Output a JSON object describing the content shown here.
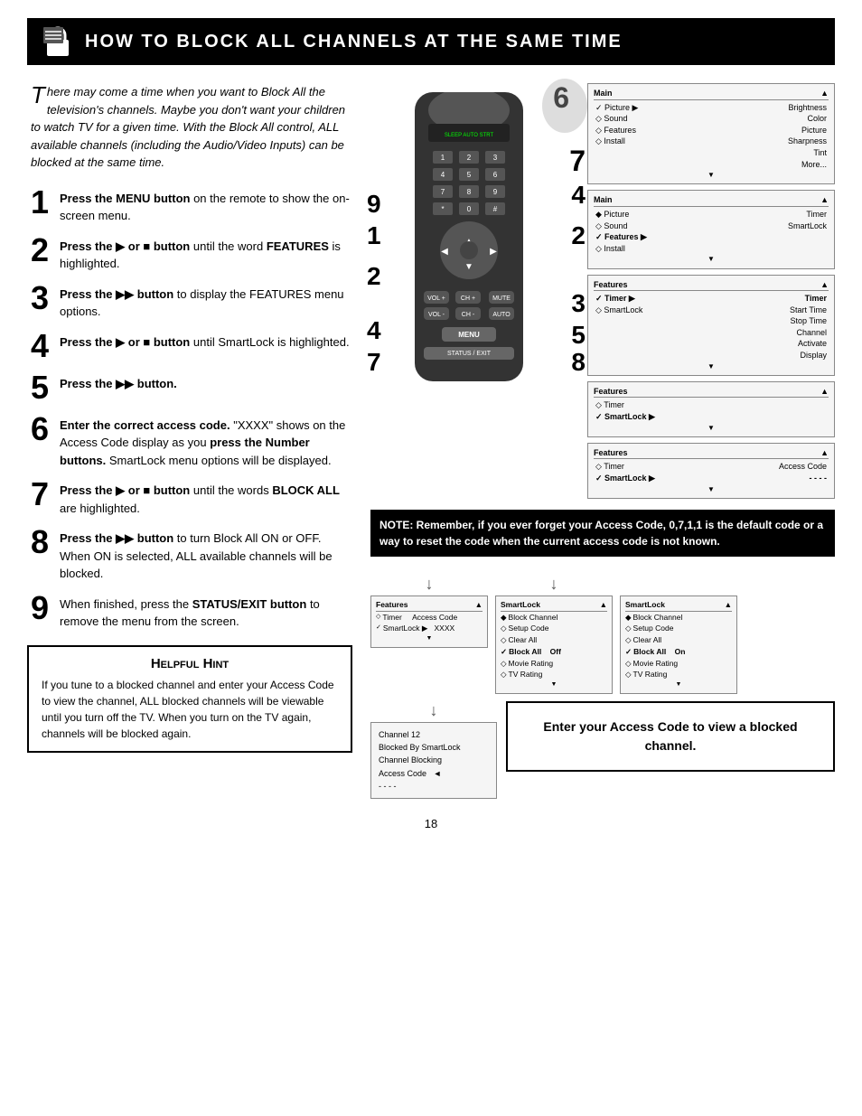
{
  "header": {
    "title": "How to Block All Channels at the Same Time",
    "icon_label": "lock-icon"
  },
  "intro": {
    "dropcap": "T",
    "text": "here may come a time when you want to Block All the television's channels. Maybe you don't want your children to watch TV for a given time. With the Block All control, ALL available channels (including the Audio/Video Inputs) can be blocked at the same time."
  },
  "steps": [
    {
      "number": "1",
      "text": "Press the ",
      "bold1": "MENU button",
      "text2": " on the remote to show the on-screen menu."
    },
    {
      "number": "2",
      "text": "Press the ▶ or ■ button",
      "text2": " until the word ",
      "bold2": "FEATURES",
      "text3": " is highlighted."
    },
    {
      "number": "3",
      "text": "Press the ▶▶ button",
      "text2": " to display the FEATURES menu options."
    },
    {
      "number": "4",
      "text": "Press the ▶ or ■ button",
      "text2": " until SmartLock is highlighted."
    },
    {
      "number": "5",
      "text": "Press the ▶▶ button."
    },
    {
      "number": "6",
      "text": "Enter the correct access code.",
      "text2": " \"XXXX\" shows on the Access Code display as you ",
      "bold2": "press the Number buttons.",
      "text3": " SmartLock menu options will be displayed."
    },
    {
      "number": "7",
      "text": "Press the ▶ or ■ button",
      "text2": " until the words ",
      "bold2": "BLOCK ALL",
      "text3": " are highlighted."
    },
    {
      "number": "8",
      "text": "Press the ▶▶ button",
      "text2": " to turn Block All ON or OFF. When ON is selected, ALL available channels will be blocked."
    },
    {
      "number": "9",
      "text": "When finished, press the ",
      "bold1": "STATUS/EXIT button",
      "text2": " to remove the menu from the screen."
    }
  ],
  "hint": {
    "title": "Helpful Hint",
    "text": "If you tune to a blocked channel and enter your Access Code to view the channel, ALL blocked channels will be viewable until you turn off the TV. When you turn on the TV again, channels will be blocked again."
  },
  "note": {
    "text": "NOTE: Remember, if you ever forget your Access Code, 0,7,1,1 is the default code or a way to reset the code when the current access code is not known."
  },
  "menus": {
    "main_menu": {
      "title": "Main",
      "items": [
        "✓ Picture ▶ Brightness",
        "◇ Sound    Color",
        "◇ Features  Picture",
        "◇ Install   Sharpness",
        "         Tint",
        "         More..."
      ]
    },
    "main_menu2": {
      "title": "Main",
      "items": [
        "◆ Picture   Timer",
        "◇ Sound    SmartLock",
        "✓ Features ▶",
        "◇ Install"
      ]
    },
    "features_menu": {
      "title": "Features",
      "items": [
        "✓ Timer ▶ Timer",
        "◇ SmartLock  Start Time",
        "           Stop Time",
        "           Channel",
        "           Activate",
        "           Display"
      ]
    },
    "features_menu2": {
      "title": "Features",
      "items": [
        "◇ Timer",
        "✓ SmartLock ▶"
      ]
    },
    "smartlock_access": {
      "title": "Features",
      "items": [
        "◇ Timer    Access Code",
        "✓ SmartLock ▶  - - - -"
      ]
    },
    "smartlock_menu": {
      "title": "SmartLock",
      "items": [
        "◆ Block Channel",
        "◇ Setup Code",
        "◇ Clear All",
        "✓ Block All   Off",
        "◇ Movie Rating",
        "◇ TV Rating"
      ]
    },
    "smartlock_menu2": {
      "title": "SmartLock",
      "items": [
        "◆ Block Channel",
        "◇ Setup Code",
        "◇ Clear All",
        "✓ Block All   On",
        "◇ Movie Rating",
        "◇ TV Rating"
      ]
    },
    "smartlock_xxxx": {
      "title": "Features",
      "items": [
        "◇ Timer    Access Code",
        "✓ SmartLock ▶  XXXX"
      ]
    }
  },
  "channel_blocked": {
    "lines": [
      "Channel 12",
      "Blocked By SmartLock",
      "Channel Blocking",
      "Access Code",
      "◄",
      "- - - -"
    ]
  },
  "enter_code": "Enter your Access Code to view a blocked channel.",
  "page_number": "18",
  "remote": {
    "screen_text": "SLEEP  AUTO STRT/STRM",
    "numbers": [
      "1",
      "2",
      "3",
      "4",
      "5",
      "6",
      "7",
      "8",
      "9",
      "*",
      "0",
      "#"
    ]
  }
}
